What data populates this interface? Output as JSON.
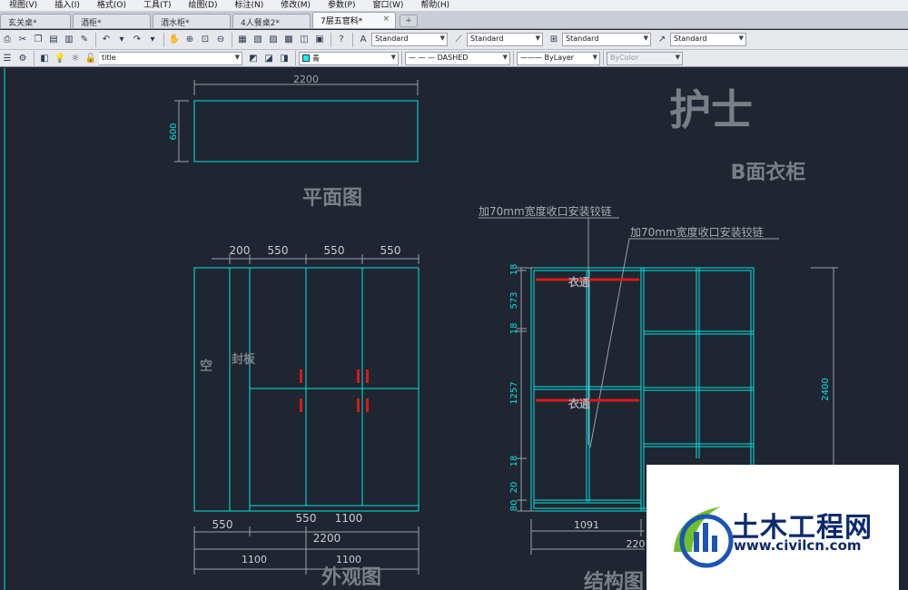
{
  "menu": [
    "视图(V)",
    "插入(I)",
    "格式(O)",
    "工具(T)",
    "绘图(D)",
    "标注(N)",
    "修改(M)",
    "参数(P)",
    "窗口(W)",
    "帮助(H)"
  ],
  "tabs": [
    {
      "label": "玄关桌*",
      "close": ""
    },
    {
      "label": "酒柜*",
      "close": ""
    },
    {
      "label": "酒水柜*",
      "close": ""
    },
    {
      "label": "4人餐桌2*",
      "close": ""
    },
    {
      "label": "7层五官科*",
      "close": "×",
      "active": true
    }
  ],
  "toolbar1": {
    "text_style": "Standard",
    "dim_style": "Standard",
    "table_style": "Standard",
    "multileader_style": "Standard"
  },
  "toolbar2": {
    "layer": "title",
    "color": "青",
    "linetype": "DASHED",
    "lineweight": "ByLayer",
    "plotstyle": "ByColor"
  },
  "drawing": {
    "plan": {
      "title": "平面图",
      "dim_width": "2200",
      "dim_depth": "600"
    },
    "elevation": {
      "title": "外观图",
      "dims_top": [
        "200",
        "550",
        "550",
        "550"
      ],
      "label_empty": "空",
      "label_panel": "封板",
      "dims_bottom_1": [
        "550",
        "550",
        "1100"
      ],
      "dim_total": "2200",
      "dims_bottom_3": [
        "1100",
        "1100"
      ]
    },
    "structure": {
      "title": "结构图",
      "room": "护士",
      "subtitle": "B面衣柜",
      "note1": "加70mm宽度收口安装铰链",
      "note2": "加70mm宽度收口安装铰链",
      "rail_label": "衣通",
      "dims_left": [
        "18",
        "573",
        "18",
        "1257",
        "18",
        "20",
        "80"
      ],
      "dim_height": "2400",
      "dim_bottom_1": "1091",
      "dim_bottom_2": "220"
    }
  },
  "watermark": {
    "name": "土木工程网",
    "url": "www.civilcn.com"
  },
  "colors": {
    "background": "#1f2631",
    "lines": "#00e5e5",
    "labels": "#7a7f86",
    "hinge": "#d81818"
  }
}
